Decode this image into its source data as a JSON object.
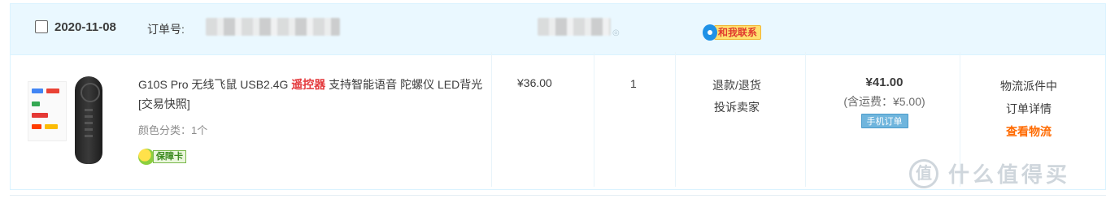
{
  "order": {
    "date": "2020-11-08",
    "order_no_label": "订单号:",
    "contact_label": "和我联系"
  },
  "item": {
    "title_part1": "G10S Pro 无线飞鼠 USB2.4G ",
    "title_highlight": "遥控器",
    "title_part2": " 支持智能语音 陀螺仪 LED背光 [交易快照]",
    "sku": "颜色分类：1个",
    "badge": "保障卡",
    "price": "¥36.00",
    "quantity": "1"
  },
  "after_sale": {
    "refund": "退款/退货",
    "complain": "投诉卖家"
  },
  "total": {
    "amount": "¥41.00",
    "shipping": "(含运费：¥5.00)",
    "pay_tag": "手机订单"
  },
  "status": {
    "state": "物流派件中",
    "detail": "订单详情",
    "logistics": "查看物流"
  },
  "watermark": {
    "logo": "值",
    "text": "什么值得买"
  },
  "colors": {
    "header_bg": "#eaf8ff",
    "accent_red": "#e4393c",
    "logistics_orange": "#ff6a00",
    "pay_tag_blue": "#6fb5dd"
  }
}
